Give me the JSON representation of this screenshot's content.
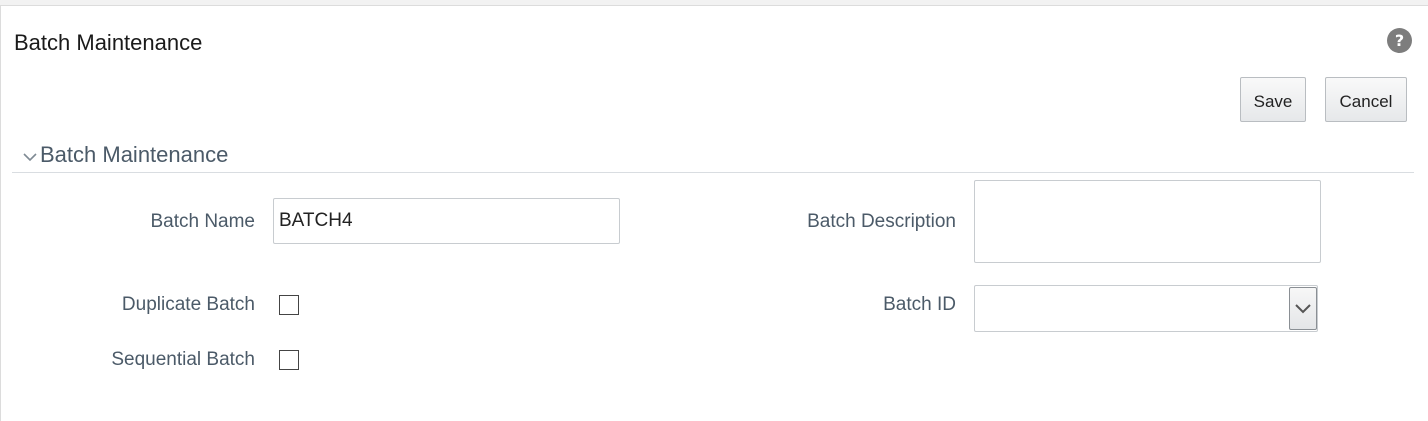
{
  "page": {
    "title": "Batch Maintenance"
  },
  "toolbar": {
    "save_label": "Save",
    "cancel_label": "Cancel",
    "help_glyph": "?"
  },
  "section": {
    "title": "Batch Maintenance",
    "collapse_icon": "chevron-down-icon"
  },
  "form": {
    "batch_name": {
      "label": "Batch Name",
      "value": "BATCH4"
    },
    "batch_description": {
      "label": "Batch Description",
      "value": ""
    },
    "duplicate_batch": {
      "label": "Duplicate Batch",
      "checked": false
    },
    "sequential_batch": {
      "label": "Sequential Batch",
      "checked": false
    },
    "batch_id": {
      "label": "Batch ID",
      "selected": ""
    }
  },
  "colors": {
    "label": "#4b5a68",
    "title": "#1a1a1a",
    "help_icon": "#7d7d7d"
  }
}
